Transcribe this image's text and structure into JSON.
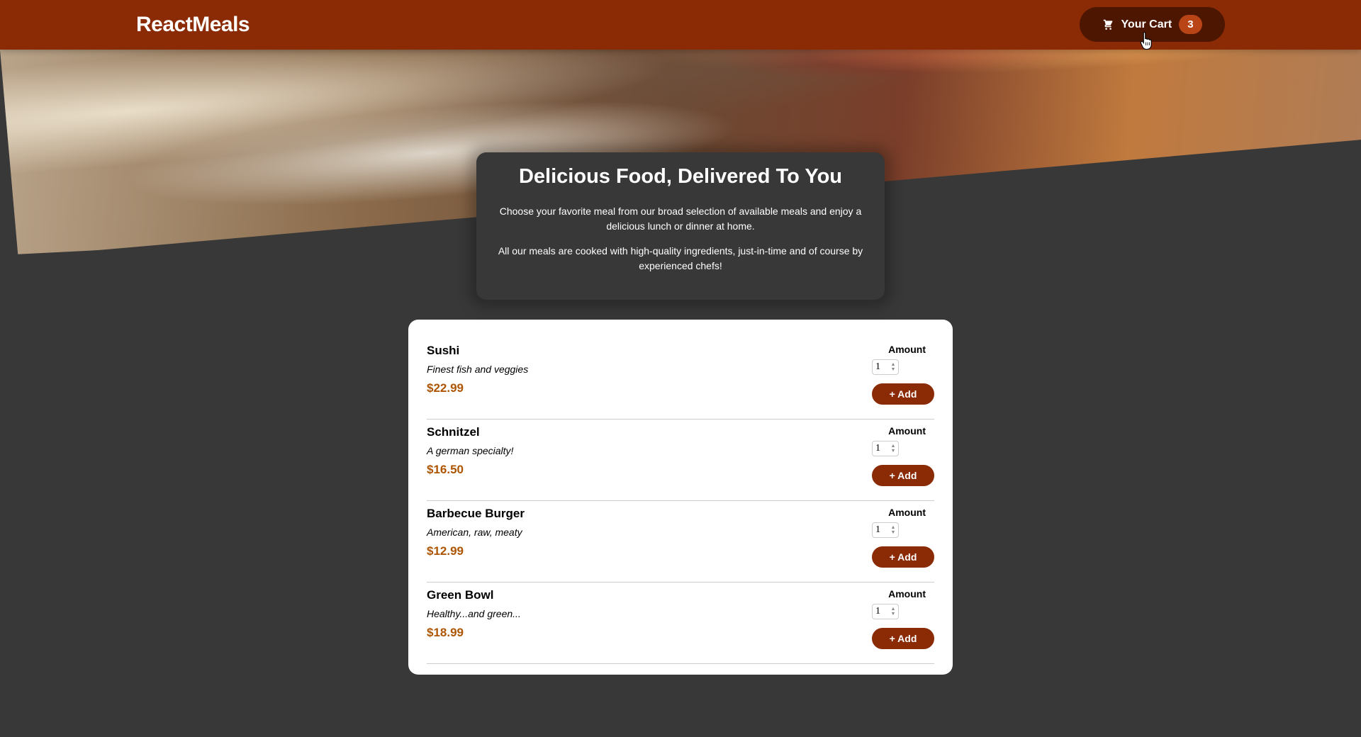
{
  "header": {
    "logo": "ReactMeals",
    "cart": {
      "label": "Your Cart",
      "count": "3",
      "icon": "cart-icon"
    }
  },
  "summary": {
    "title": "Delicious Food, Delivered To You",
    "paragraph1": "Choose your favorite meal from our broad selection of available meals and enjoy a delicious lunch or dinner at home.",
    "paragraph2": "All our meals are cooked with high-quality ingredients, just-in-time and of course by experienced chefs!"
  },
  "meals": [
    {
      "name": "Sushi",
      "description": "Finest fish and veggies",
      "price": "$22.99",
      "amount_label": "Amount",
      "amount": "1",
      "add_label": "+ Add"
    },
    {
      "name": "Schnitzel",
      "description": "A german specialty!",
      "price": "$16.50",
      "amount_label": "Amount",
      "amount": "1",
      "add_label": "+ Add"
    },
    {
      "name": "Barbecue Burger",
      "description": "American, raw, meaty",
      "price": "$12.99",
      "amount_label": "Amount",
      "amount": "1",
      "add_label": "+ Add"
    },
    {
      "name": "Green Bowl",
      "description": "Healthy...and green...",
      "price": "$18.99",
      "amount_label": "Amount",
      "amount": "1",
      "add_label": "+ Add"
    }
  ],
  "colors": {
    "header": "#8a2b06",
    "cart_button": "#4d1601",
    "badge": "#b94517",
    "price": "#ad5502",
    "background": "#383838"
  }
}
